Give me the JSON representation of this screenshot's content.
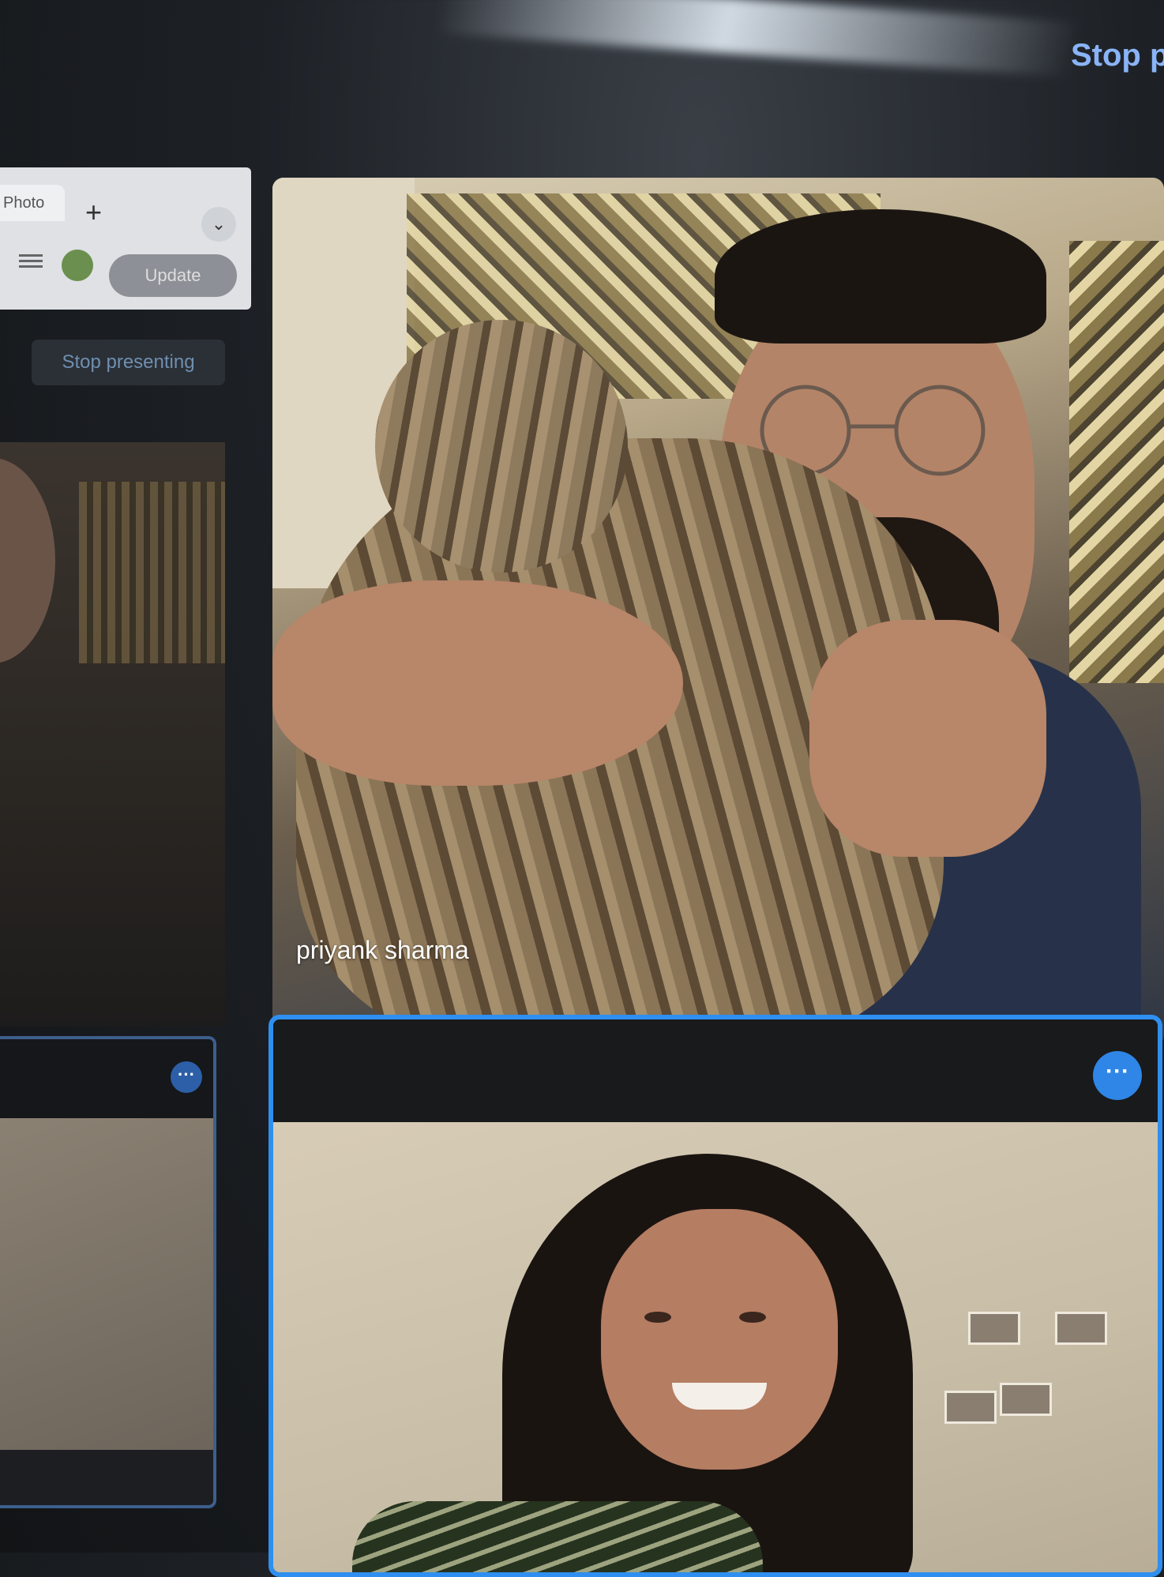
{
  "top_bar": {
    "stop_label": "Stop p"
  },
  "browser_strip": {
    "tab_label": "Photo",
    "update_label": "Update"
  },
  "left_panel": {
    "stop_presenting_label": "Stop presenting"
  },
  "participants": [
    {
      "name": "priyank sharma"
    },
    {
      "name": ""
    }
  ],
  "icons": {
    "plus": "plus-icon",
    "chevron": "chevron-down-icon",
    "more": "more-options-icon",
    "list": "list-icon",
    "extension": "extension-icon"
  },
  "colors": {
    "active_speaker_border": "#2e8ff0",
    "more_button": "#2f86e6",
    "stop_text": "#8ab4f8"
  }
}
